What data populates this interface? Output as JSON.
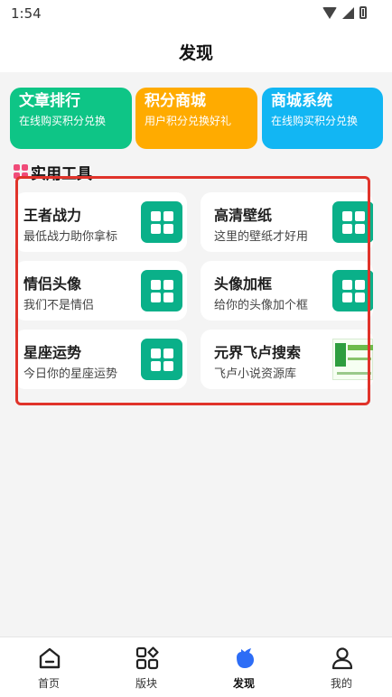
{
  "status_bar": {
    "time": "1:54"
  },
  "header": {
    "title": "发现"
  },
  "promo_cards": [
    {
      "title": "文章排行",
      "desc": "在线购买积分兑换",
      "color": "#0ec586"
    },
    {
      "title": "积分商城",
      "desc": "用户积分兑换好礼",
      "color": "#ffab00"
    },
    {
      "title": "商城系统",
      "desc": "在线购买积分兑换",
      "color": "#12b6f3"
    }
  ],
  "section": {
    "title": "实用工具"
  },
  "tools": [
    {
      "name": "王者战力",
      "desc": "最低战力助你拿标",
      "icon": "grid-icon"
    },
    {
      "name": "高清壁纸",
      "desc": "这里的壁纸才好用",
      "icon": "grid-icon"
    },
    {
      "name": "情侣头像",
      "desc": "我们不是情侣",
      "icon": "grid-icon"
    },
    {
      "name": "头像加框",
      "desc": "给你的头像加个框",
      "icon": "grid-icon"
    },
    {
      "name": "星座运势",
      "desc": "今日你的星座运势",
      "icon": "grid-icon"
    },
    {
      "name": "元界飞卢搜索",
      "desc": "飞卢小说资源库",
      "icon": "novel-logo-icon"
    }
  ],
  "bottom_nav": [
    {
      "label": "首页",
      "icon": "home-icon",
      "active": false
    },
    {
      "label": "版块",
      "icon": "apps-icon",
      "active": false
    },
    {
      "label": "发现",
      "icon": "discover-icon",
      "active": true
    },
    {
      "label": "我的",
      "icon": "profile-icon",
      "active": false
    }
  ],
  "colors": {
    "accent": "#0ab089",
    "nav_active": "#2d6df6",
    "highlight": "#e0332a"
  }
}
